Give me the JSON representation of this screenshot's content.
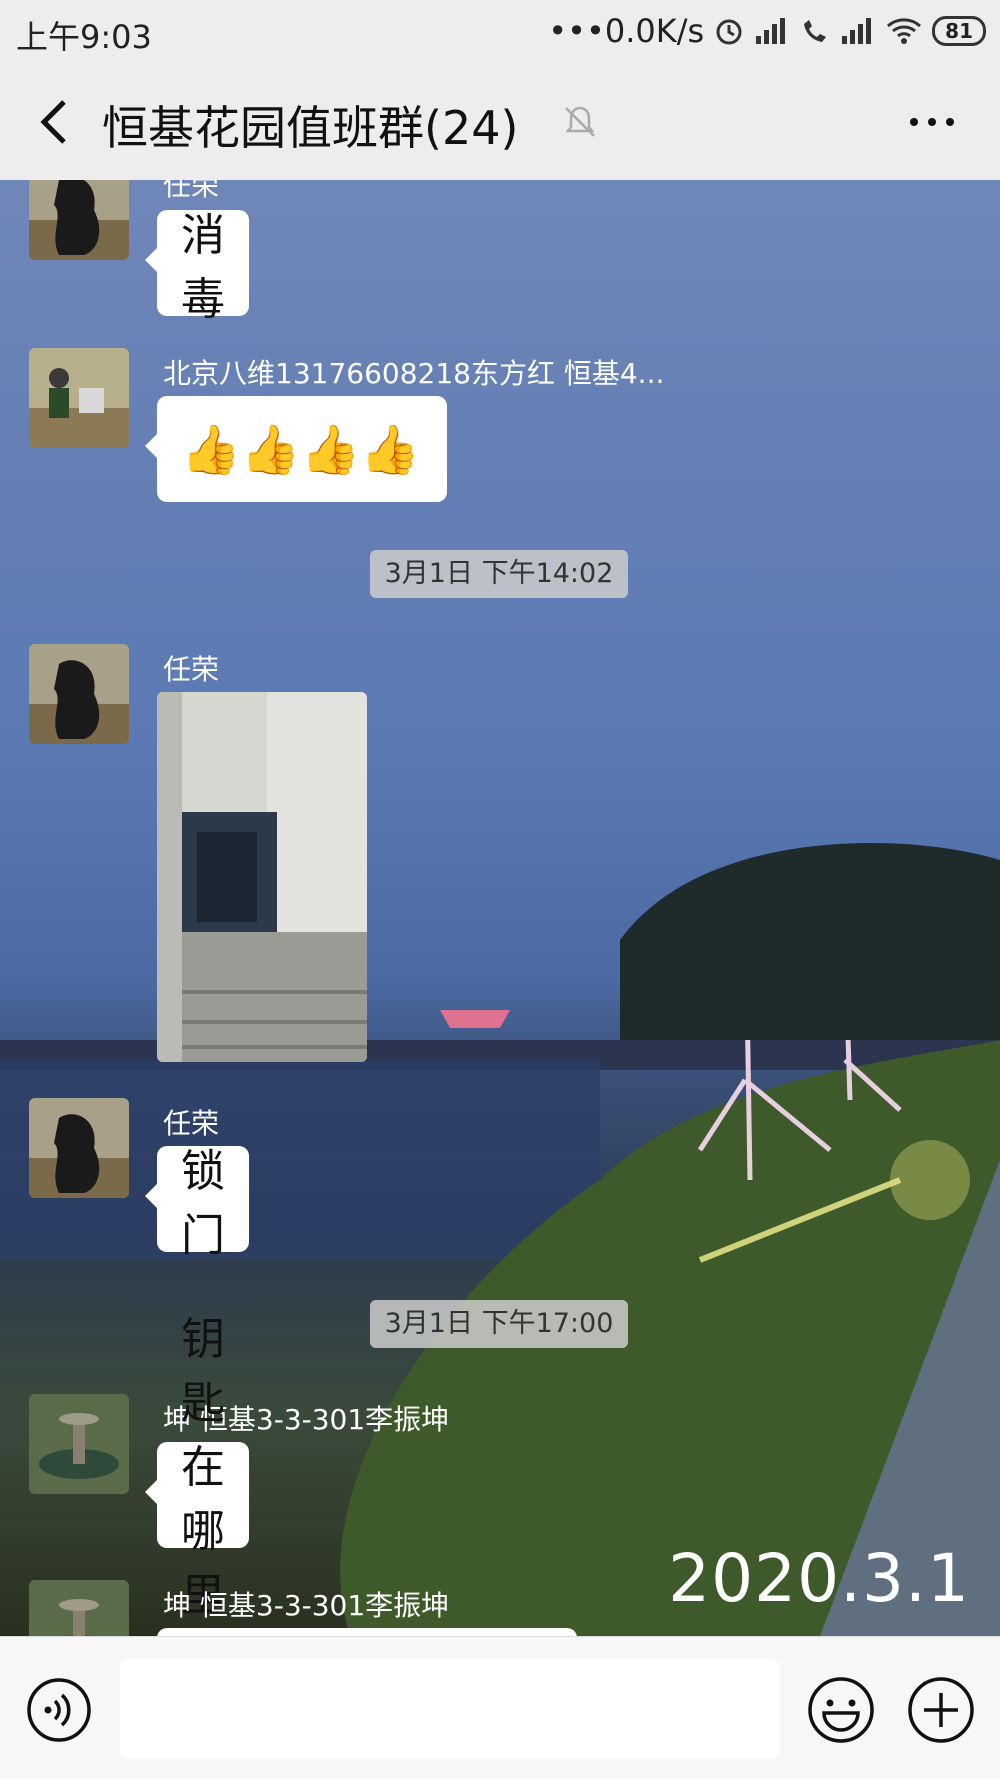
{
  "status_bar": {
    "time": "上午9:03",
    "network_speed": "0.0K/s",
    "battery": "81"
  },
  "header": {
    "title": "恒基花园值班群(24)"
  },
  "messages": [
    {
      "sender": "任荣",
      "text": "消毒"
    },
    {
      "sender": "北京八维13176608218东方红 恒基4...",
      "text": "👍👍👍👍"
    },
    {
      "timestamp": "3月1日 下午14:02"
    },
    {
      "sender": "任荣",
      "type": "image"
    },
    {
      "sender": "任荣",
      "text": "锁门"
    },
    {
      "timestamp": "3月1日 下午17:00"
    },
    {
      "sender": "坤 恒基3-3-301李振坤",
      "text": "钥匙在哪里的"
    },
    {
      "sender": "坤 恒基3-3-301李振坤"
    }
  ],
  "watermark": "2020.3.1",
  "colors": {
    "bubble": "#ffffff",
    "chat_bg_top": "#6f86b8",
    "bar_bg": "#ededed"
  }
}
